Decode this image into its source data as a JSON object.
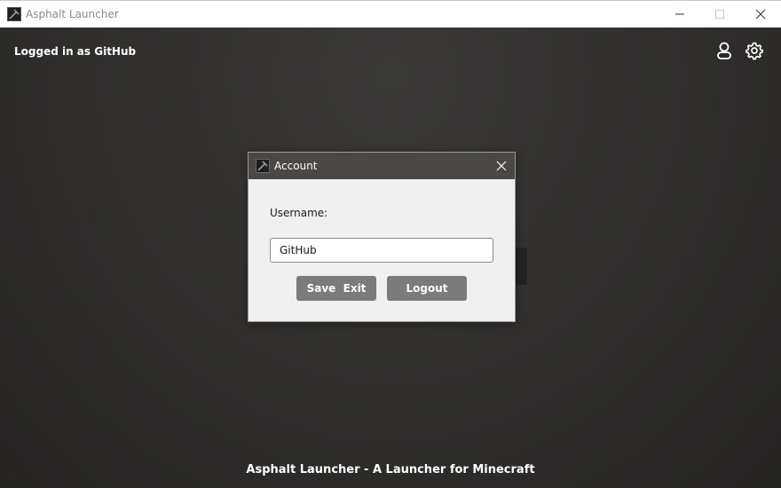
{
  "window": {
    "title": "Asphalt Launcher",
    "controls": {
      "minimize": "minimize-icon",
      "maximize": "maximize-icon",
      "close": "close-icon"
    }
  },
  "header": {
    "login_status": "Logged in as GitHub",
    "icons": [
      "user-icon",
      "gear-icon"
    ]
  },
  "footer": {
    "text": "Asphalt Launcher - A Launcher for Minecraft"
  },
  "dialog": {
    "title": "Account",
    "username_label": "Username:",
    "username_value": "GitHub",
    "save_exit_label": "Save  Exit",
    "logout_label": "Logout"
  },
  "colors": {
    "background": "#2e2d2c",
    "dialog_titlebar": "#4a4847",
    "dialog_body": "#f0f0f0",
    "button": "#7b7b7b"
  }
}
